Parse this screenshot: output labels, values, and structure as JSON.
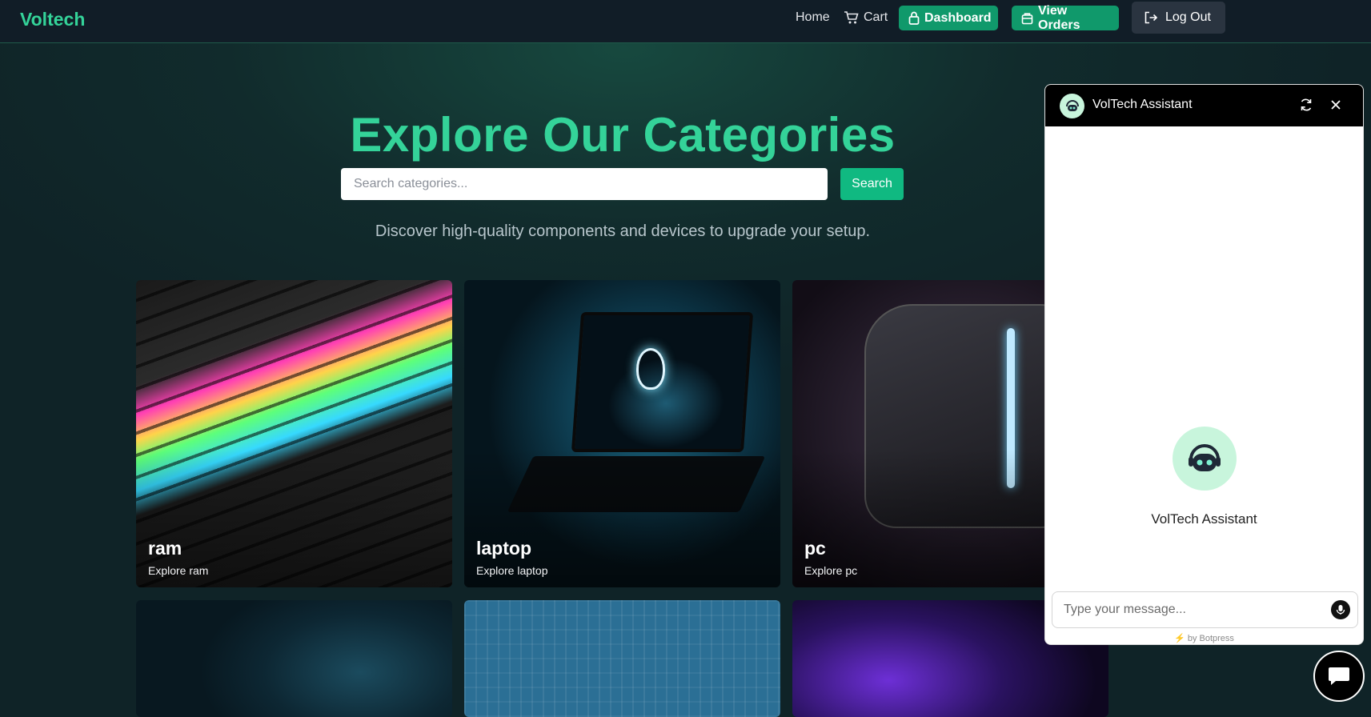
{
  "navbar": {
    "brand": "Voltech",
    "home": "Home",
    "cart": "Cart",
    "dashboard": "Dashboard",
    "view_orders": "View Orders",
    "logout": "Log Out"
  },
  "hero": {
    "title": "Explore Our Categories",
    "search_placeholder": "Search categories...",
    "search_button": "Search",
    "subtitle": "Discover high-quality components and devices to upgrade your setup."
  },
  "categories": [
    {
      "name": "ram",
      "cta": "Explore ram"
    },
    {
      "name": "laptop",
      "cta": "Explore laptop"
    },
    {
      "name": "pc",
      "cta": "Explore pc"
    }
  ],
  "chat": {
    "title": "VolTech Assistant",
    "bot_name": "VolTech Assistant",
    "input_placeholder": "Type your message...",
    "powered_by": "by Botpress"
  },
  "colors": {
    "accent": "#34d399",
    "button_green": "#10996b",
    "background": "#0f2327"
  },
  "icons": [
    "cart-icon",
    "lock-icon",
    "package-icon",
    "logout-icon",
    "refresh-icon",
    "close-icon",
    "bot-icon",
    "mic-icon",
    "chat-bubble-icon",
    "bolt-icon"
  ]
}
